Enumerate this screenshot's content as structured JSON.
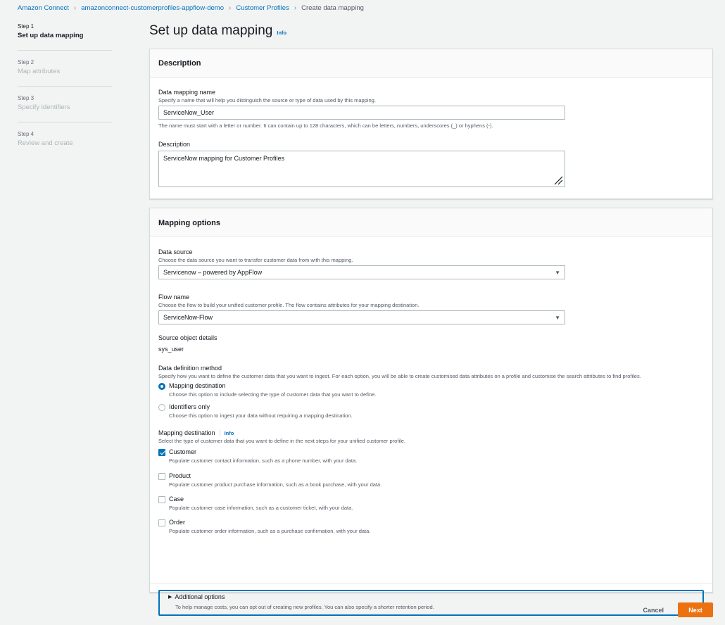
{
  "breadcrumb": [
    {
      "label": "Amazon Connect"
    },
    {
      "label": "amazonconnect-customerprofiles-appflow-demo"
    },
    {
      "label": "Customer Profiles"
    },
    {
      "label": "Create data mapping"
    }
  ],
  "steps": [
    {
      "num": "Step 1",
      "label": "Set up data mapping"
    },
    {
      "num": "Step 2",
      "label": "Map attributes"
    },
    {
      "num": "Step 3",
      "label": "Specify identifiers"
    },
    {
      "num": "Step 4",
      "label": "Review and create"
    }
  ],
  "page": {
    "title": "Set up data mapping",
    "info": "Info"
  },
  "description_panel": {
    "header": "Description",
    "name_label": "Data mapping name",
    "name_desc": "Specify a name that will help you distinguish the source or type of data used by this mapping.",
    "name_value": "ServiceNow_User",
    "name_constraint": "The name must start with a letter or number. It can contain up to 128 characters, which can be letters, numbers, underscores (_) or hyphens (-).",
    "desc_label": "Description",
    "desc_value": "ServiceNow mapping for Customer Profiles"
  },
  "mapping_panel": {
    "header": "Mapping options",
    "source_label": "Data source",
    "source_desc": "Choose the data source you want to transfer customer data from with this mapping.",
    "source_value": "Servicenow – powered by AppFlow",
    "flow_label": "Flow name",
    "flow_desc": "Choose the flow to build your unified customer profile. The flow contains attributes for your mapping destination.",
    "flow_value": "ServiceNow-Flow",
    "object_label": "Source object details",
    "object_value": "sys_user",
    "method_label": "Data definition method",
    "method_desc": "Specify how you want to define the customer data that you want to ingest. For each option, you will be able to create customised data attributes on a profile and customise the search attributes to find profiles.",
    "methods": [
      {
        "title": "Mapping destination",
        "desc": "Choose this option to include selecting the type of customer data that you want to define."
      },
      {
        "title": "Identifiers only",
        "desc": "Choose this option to ingest your data without requiring a mapping destination."
      }
    ],
    "dest_label": "Mapping destination",
    "dest_info": "Info",
    "dest_desc": "Select the type of customer data that you want to define in the next steps for your unified customer profile.",
    "destinations": [
      {
        "title": "Customer",
        "desc": "Populate customer contact information, such as a phone number, with your data."
      },
      {
        "title": "Product",
        "desc": "Populate customer product purchase information, such as a book purchase, with your data."
      },
      {
        "title": "Case",
        "desc": "Populate customer case information, such as a customer ticket, with your data."
      },
      {
        "title": "Order",
        "desc": "Populate customer order information, such as a purchase confirmation, with your data."
      }
    ],
    "additional_title": "Additional options",
    "additional_desc": "To help manage costs, you can opt out of creating new profiles. You can also specify a shorter retention period."
  },
  "footer": {
    "cancel": "Cancel",
    "next": "Next"
  },
  "colors": {
    "accent": "#0073bb",
    "primary_button": "#ec7211"
  }
}
